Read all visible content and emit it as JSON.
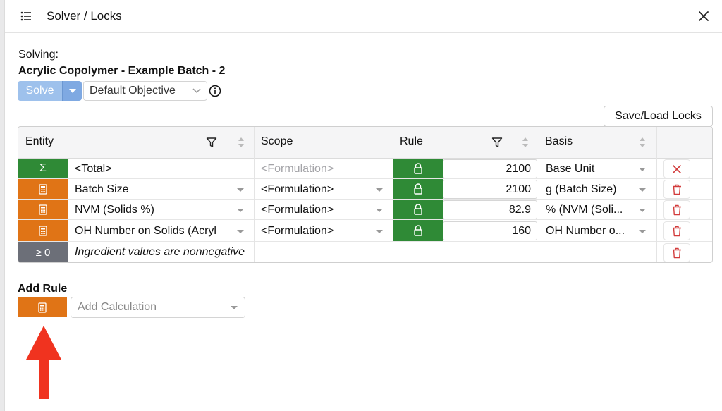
{
  "header": {
    "title": "Solver / Locks",
    "menu_icon": "list-icon",
    "close_icon": "close-icon"
  },
  "solving": {
    "label": "Solving:",
    "batch_name": "Acrylic Copolymer - Example Batch - 2"
  },
  "actions": {
    "solve_label": "Solve",
    "objective_value": "Default Objective",
    "save_load_label": "Save/Load Locks"
  },
  "table": {
    "columns": {
      "entity": "Entity",
      "scope": "Scope",
      "rule": "Rule",
      "basis": "Basis"
    },
    "rows": [
      {
        "badge": "Σ",
        "badge_color": "#2f8a36",
        "entity": "<Total>",
        "scope": "<Formulation>",
        "value": "2100",
        "basis": "Base Unit",
        "action": "remove"
      },
      {
        "badge": "calculator-icon",
        "badge_color": "#e07416",
        "entity": "Batch Size",
        "scope": "<Formulation>",
        "value": "2100",
        "basis": "g (Batch Size)",
        "action": "delete"
      },
      {
        "badge": "calculator-icon",
        "badge_color": "#e07416",
        "entity": "NVM (Solids %)",
        "scope": "<Formulation>",
        "value": "82.9",
        "basis": "% (NVM (Soli...",
        "action": "delete"
      },
      {
        "badge": "calculator-icon",
        "badge_color": "#e07416",
        "entity": "OH Number on Solids (Acryl",
        "scope": "<Formulation>",
        "value": "160",
        "basis": "OH Number o...",
        "action": "delete"
      }
    ],
    "constraint": {
      "badge": "≥ 0",
      "text": "Ingredient values are nonnegative"
    }
  },
  "add_rule": {
    "label": "Add Rule",
    "placeholder": "Add Calculation"
  },
  "colors": {
    "accent_blue": "#9ec1ec",
    "lock_green": "#2f8a36",
    "calc_orange": "#e07416",
    "delete_red": "#d23b3b",
    "arrow_red": "#f0331f"
  }
}
